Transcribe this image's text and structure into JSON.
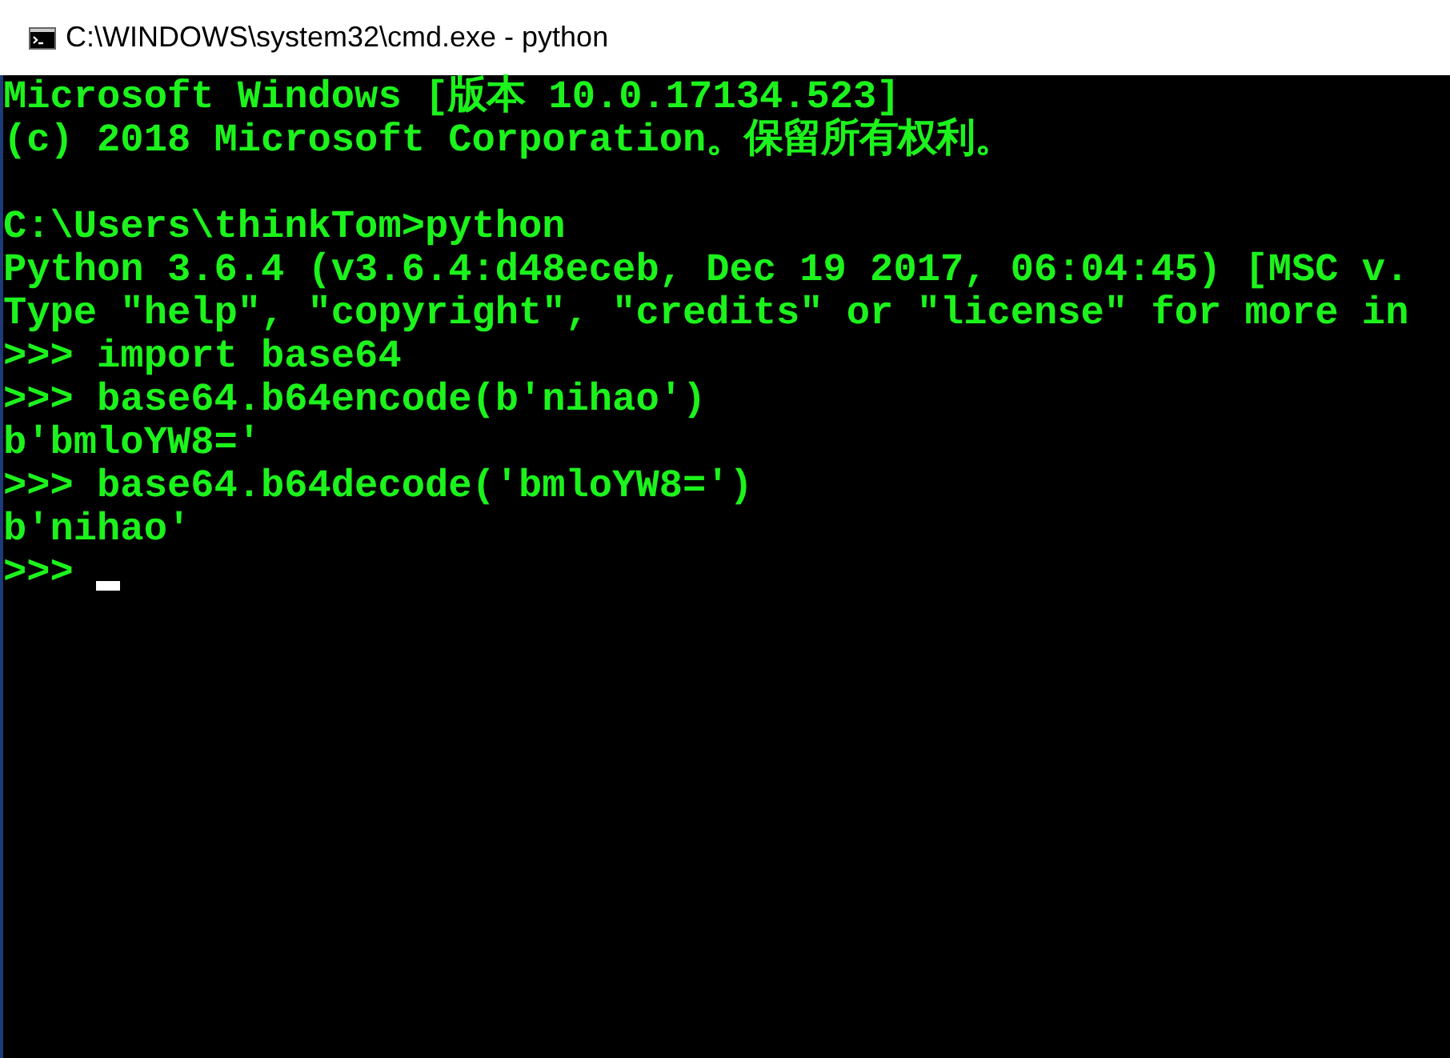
{
  "window": {
    "title": "C:\\WINDOWS\\system32\\cmd.exe - python"
  },
  "console": {
    "lines": [
      {
        "kind": "text",
        "text": "Microsoft Windows [版本 10.0.17134.523]"
      },
      {
        "kind": "text",
        "text": "(c) 2018 Microsoft Corporation。保留所有权利。"
      },
      {
        "kind": "blank"
      },
      {
        "kind": "text",
        "text": "C:\\Users\\thinkTom>python"
      },
      {
        "kind": "text",
        "text": "Python 3.6.4 (v3.6.4:d48eceb, Dec 19 2017, 06:04:45) [MSC v."
      },
      {
        "kind": "text",
        "text": "Type \"help\", \"copyright\", \"credits\" or \"license\" for more in"
      },
      {
        "kind": "text",
        "text": ">>> import base64"
      },
      {
        "kind": "text",
        "text": ">>> base64.b64encode(b'nihao')"
      },
      {
        "kind": "text",
        "text": "b'bmloYW8='"
      },
      {
        "kind": "text",
        "text": ">>> base64.b64decode('bmloYW8=')"
      },
      {
        "kind": "text",
        "text": "b'nihao'"
      },
      {
        "kind": "prompt",
        "text": ">>>",
        "cursor": true
      }
    ]
  }
}
